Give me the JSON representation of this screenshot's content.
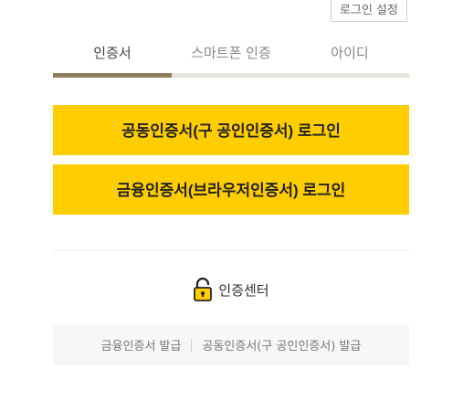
{
  "header": {
    "login_settings_label": "로그인 설정"
  },
  "tabs": [
    {
      "label": "인증서",
      "active": true
    },
    {
      "label": "스마트폰 인증",
      "active": false
    },
    {
      "label": "아이디",
      "active": false
    }
  ],
  "buttons": {
    "joint_cert_login": "공동인증서(구 공인인증서) 로그인",
    "financial_cert_login": "금융인증서(브라우저인증서) 로그인"
  },
  "auth_center": {
    "icon": "lock-icon",
    "label": "인증센터"
  },
  "footer": {
    "financial_cert_issue": "금융인증서 발급",
    "joint_cert_issue": "공동인증서(구 공인인증서) 발급"
  },
  "colors": {
    "accent_yellow": "#ffcd00",
    "tab_active_bar": "#8b7d5a",
    "tab_inactive_bar": "#e8e4de"
  }
}
